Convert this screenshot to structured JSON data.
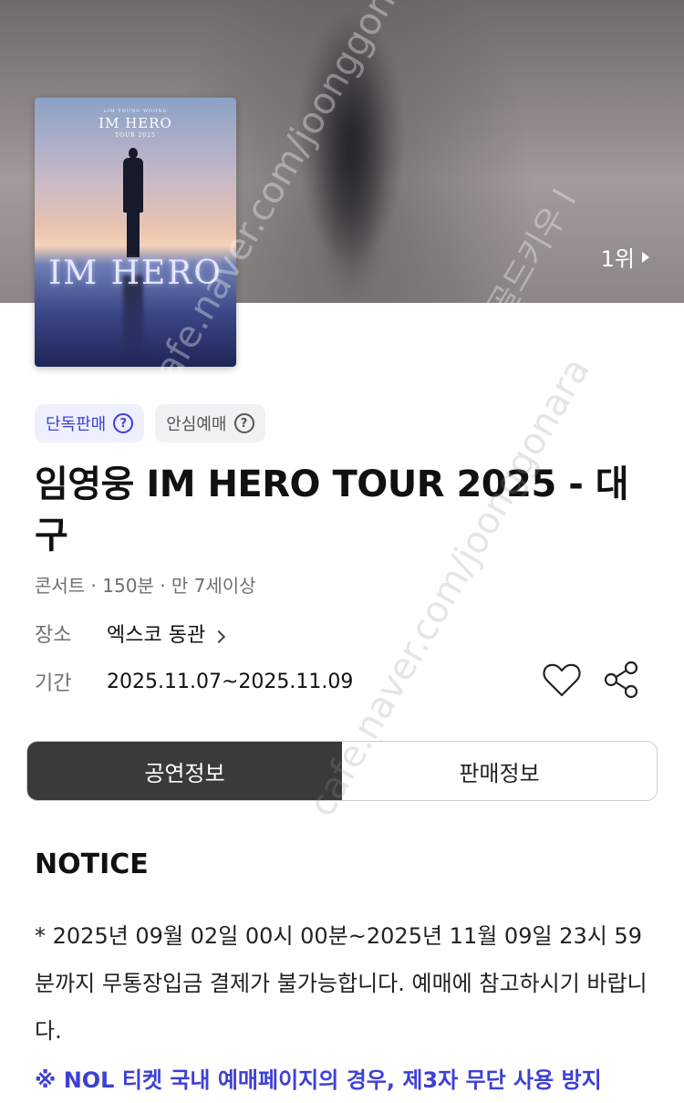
{
  "hero": {
    "rank_label": "1위",
    "poster": {
      "artist_small": "LIM YOUNG WOONG",
      "title": "IM HERO",
      "tour": "TOUR 2025",
      "logo": "IM HERO"
    }
  },
  "badges": {
    "exclusive": "단독판매",
    "safe_booking": "안심예매"
  },
  "event": {
    "title": "임영웅 IM HERO TOUR 2025 - 대구",
    "meta": "콘서트 · 150분 · 만 7세이상",
    "venue_label": "장소",
    "venue_value": "엑스코 동관",
    "period_label": "기간",
    "period_value": "2025.11.07~2025.11.09"
  },
  "tabs": [
    {
      "label": "공연정보",
      "active": true
    },
    {
      "label": "판매정보",
      "active": false
    }
  ],
  "notice": {
    "heading": "NOTICE",
    "body": "* 2025년 09월 02일 00시 00분~2025년 11월 09일 23시 59분까지 무통장입금 결제가 불가능합니다. 예매에 참고하시기 바랍니다.",
    "highlight": "※ NOL 티켓 국내 예매페이지의 경우, 제3자 무단 사용 방지"
  },
  "watermarks": {
    "site": "cafe.naver.com/joonggonara",
    "brand": "골드키우 l"
  },
  "colors": {
    "accent": "#3d40d6",
    "active_tab_bg": "#3a3a3a"
  },
  "icons": [
    "question-icon",
    "chevron-right-icon",
    "heart-icon",
    "share-icon",
    "play-triangle-icon"
  ]
}
